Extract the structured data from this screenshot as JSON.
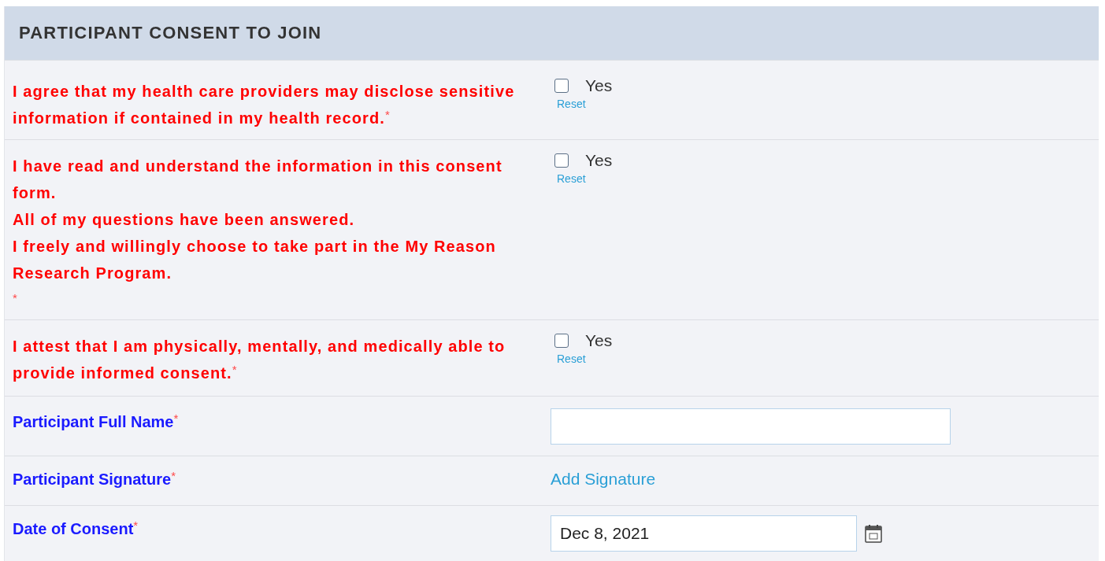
{
  "section": {
    "title": "PARTICIPANT CONSENT TO JOIN"
  },
  "consent_items": [
    {
      "lines": [
        "I agree that my health care providers may disclose sensitive information if contained in my health record."
      ],
      "required_mark": "*",
      "mark_on_own_line": false,
      "option": "Yes",
      "checked": false,
      "reset": "Reset"
    },
    {
      "lines": [
        "I have read and understand the information in this consent form.",
        "All of my questions have been answered.",
        "I freely and willingly choose to take part in the My Reason Research Program."
      ],
      "required_mark": "*",
      "mark_on_own_line": true,
      "option": "Yes",
      "checked": false,
      "reset": "Reset"
    },
    {
      "lines": [
        "I attest that I am physically, mentally, and medically able to provide informed consent."
      ],
      "required_mark": "*",
      "mark_on_own_line": false,
      "option": "Yes",
      "checked": false,
      "reset": "Reset"
    }
  ],
  "fields": [
    {
      "kind": "text",
      "label": "Participant Full Name",
      "required_mark": "*"
    },
    {
      "kind": "link",
      "label": "Participant Signature",
      "required_mark": "*",
      "link": "Add Signature"
    },
    {
      "kind": "date",
      "label": "Date of Consent",
      "required_mark": "*",
      "value": "Dec 8, 2021"
    }
  ]
}
